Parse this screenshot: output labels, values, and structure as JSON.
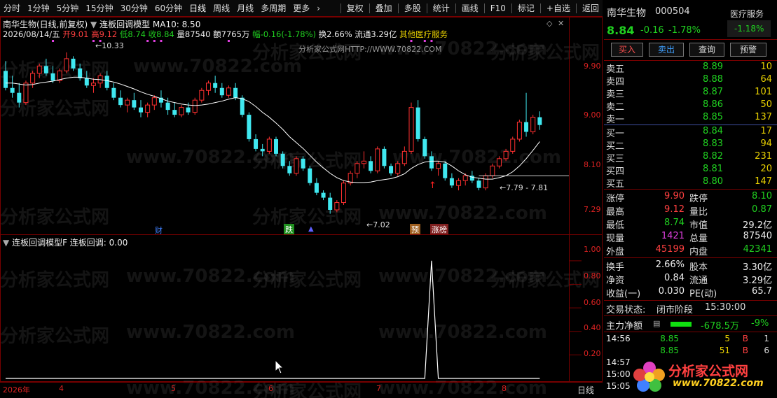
{
  "toolbar": {
    "items": [
      "分时",
      "1分钟",
      "5分钟",
      "15分钟",
      "30分钟",
      "60分钟",
      "日线",
      "周线",
      "月线",
      "多周期",
      "更多"
    ],
    "right_items": [
      "复权",
      "叠加",
      "多股",
      "统计",
      "画线",
      "F10",
      "标记",
      "+自选",
      "返回"
    ]
  },
  "header": {
    "title": "南华生物(日线,前复权)",
    "indicator": "连板回调模型",
    "ma": "MA10: 8.50",
    "date": "2026/08/14/五",
    "open_label": "开",
    "open": "9.01",
    "high_label": "高",
    "high": "9.12",
    "low_label": "低",
    "low": "8.74",
    "close_label": "收",
    "close": "8.84",
    "vol_label": "量",
    "vol": "87540",
    "amt_label": "额",
    "amt": "7765万",
    "chg_label": "幅",
    "chg": "-0.16(-1.78%)",
    "turn": "换2.66%",
    "float": "流通3.29亿",
    "sector": "其他医疗服务",
    "center_text": "分析家公式网HTTP://WWW.70822.COM"
  },
  "watermarks": [
    "分析家公式网",
    "www.70822.com"
  ],
  "price_axis": [
    "9.90",
    "9.00",
    "8.10",
    "7.29"
  ],
  "annotations": {
    "high_mark": "10.33",
    "low_mark": "7.02",
    "range_mark": "7.79 - 7.81"
  },
  "event_tags": [
    {
      "text": "财",
      "color": "#4080ff"
    },
    {
      "text": "跌",
      "color": "#20c020"
    },
    {
      "text": "预",
      "color": "#e08020"
    },
    {
      "text": "涨榜",
      "color": "#e04040"
    }
  ],
  "sub_header": {
    "name": "连板回调模型F",
    "value": "连板回调: 0.00"
  },
  "sub_axis": [
    "1.00",
    "0.80",
    "0.60",
    "0.40",
    "0.20"
  ],
  "date_axis": [
    "2026年",
    "4",
    "5",
    "6",
    "7",
    "8"
  ],
  "bottom_tab": "日线",
  "chart_data": {
    "type": "candlestick",
    "main": {
      "ylim": [
        7.0,
        10.5
      ],
      "ohlc": [
        [
          9.95,
          10.15,
          9.55,
          9.6
        ],
        [
          9.6,
          9.85,
          9.4,
          9.5
        ],
        [
          9.5,
          9.7,
          9.2,
          9.3
        ],
        [
          9.3,
          9.75,
          9.25,
          9.7
        ],
        [
          9.7,
          9.95,
          9.6,
          9.9
        ],
        [
          9.9,
          10.1,
          9.8,
          10.05
        ],
        [
          10.05,
          10.2,
          9.85,
          9.9
        ],
        [
          9.9,
          10.05,
          9.7,
          9.75
        ],
        [
          9.75,
          10.0,
          9.7,
          9.95
        ],
        [
          9.95,
          10.33,
          9.9,
          10.2
        ],
        [
          10.2,
          10.25,
          9.95,
          10.0
        ],
        [
          10.0,
          10.1,
          9.75,
          9.8
        ],
        [
          9.8,
          9.95,
          9.6,
          9.65
        ],
        [
          9.65,
          9.8,
          9.5,
          9.7
        ],
        [
          9.7,
          9.9,
          9.6,
          9.85
        ],
        [
          9.85,
          9.95,
          9.55,
          9.6
        ],
        [
          9.6,
          9.7,
          9.35,
          9.4
        ],
        [
          9.4,
          9.55,
          9.2,
          9.25
        ],
        [
          9.25,
          9.4,
          9.1,
          9.35
        ],
        [
          9.35,
          9.5,
          9.15,
          9.2
        ],
        [
          9.2,
          9.35,
          9.0,
          9.1
        ],
        [
          9.1,
          9.3,
          9.0,
          9.25
        ],
        [
          9.25,
          9.45,
          9.15,
          9.4
        ],
        [
          9.4,
          9.55,
          9.2,
          9.3
        ],
        [
          9.3,
          9.4,
          9.05,
          9.15
        ],
        [
          9.15,
          9.3,
          9.0,
          9.05
        ],
        [
          9.05,
          9.25,
          9.0,
          9.2
        ],
        [
          9.2,
          9.3,
          9.05,
          9.1
        ],
        [
          9.1,
          9.4,
          9.05,
          9.35
        ],
        [
          9.35,
          9.6,
          9.3,
          9.55
        ],
        [
          9.55,
          9.75,
          9.45,
          9.7
        ],
        [
          9.7,
          9.85,
          9.5,
          9.6
        ],
        [
          9.6,
          9.7,
          9.4,
          9.45
        ],
        [
          9.45,
          9.65,
          9.4,
          9.6
        ],
        [
          9.6,
          9.7,
          9.35,
          9.4
        ],
        [
          9.4,
          9.45,
          9.0,
          9.05
        ],
        [
          9.05,
          9.1,
          8.5,
          8.55
        ],
        [
          8.55,
          8.65,
          8.3,
          8.35
        ],
        [
          8.35,
          8.45,
          8.2,
          8.3
        ],
        [
          8.3,
          8.6,
          8.25,
          8.55
        ],
        [
          8.55,
          8.6,
          8.2,
          8.25
        ],
        [
          8.25,
          8.3,
          7.95,
          8.0
        ],
        [
          8.0,
          8.1,
          7.8,
          7.85
        ],
        [
          7.85,
          8.2,
          7.8,
          8.15
        ],
        [
          8.15,
          8.2,
          7.9,
          7.95
        ],
        [
          7.95,
          8.0,
          7.6,
          7.65
        ],
        [
          7.65,
          7.75,
          7.4,
          7.45
        ],
        [
          7.45,
          7.5,
          7.3,
          7.35
        ],
        [
          7.35,
          7.45,
          7.02,
          7.1
        ],
        [
          7.1,
          7.3,
          7.05,
          7.25
        ],
        [
          7.25,
          7.7,
          7.2,
          7.65
        ],
        [
          7.65,
          7.9,
          7.6,
          7.85
        ],
        [
          7.85,
          8.1,
          7.75,
          8.05
        ],
        [
          8.05,
          8.3,
          7.95,
          8.1
        ],
        [
          8.1,
          8.2,
          7.85,
          7.9
        ],
        [
          7.9,
          8.4,
          7.85,
          8.35
        ],
        [
          8.35,
          8.4,
          7.95,
          8.0
        ],
        [
          8.0,
          8.05,
          7.8,
          7.85
        ],
        [
          7.85,
          8.1,
          7.8,
          8.05
        ],
        [
          8.05,
          8.4,
          8.0,
          8.3
        ],
        [
          8.3,
          9.3,
          8.25,
          9.2
        ],
        [
          9.2,
          9.35,
          8.5,
          8.55
        ],
        [
          8.55,
          8.6,
          8.15,
          8.2
        ],
        [
          8.2,
          8.3,
          7.9,
          7.95
        ],
        [
          7.95,
          8.1,
          7.8,
          8.05
        ],
        [
          8.05,
          8.1,
          7.7,
          7.75
        ],
        [
          7.75,
          7.85,
          7.55,
          7.6
        ],
        [
          7.6,
          7.75,
          7.5,
          7.7
        ],
        [
          7.7,
          7.85,
          7.6,
          7.8
        ],
        [
          7.8,
          7.9,
          7.65,
          7.7
        ],
        [
          7.7,
          7.75,
          7.5,
          7.55
        ],
        [
          7.55,
          7.85,
          7.5,
          7.8
        ],
        [
          7.8,
          8.05,
          7.75,
          8.0
        ],
        [
          8.0,
          8.2,
          7.95,
          8.15
        ],
        [
          8.15,
          8.35,
          8.1,
          8.3
        ],
        [
          8.3,
          8.6,
          8.25,
          8.55
        ],
        [
          8.55,
          8.95,
          8.5,
          8.9
        ],
        [
          8.9,
          9.5,
          8.6,
          8.7
        ],
        [
          8.7,
          9.05,
          8.65,
          9.0
        ],
        [
          9.0,
          9.12,
          8.74,
          8.84
        ]
      ],
      "ma10": [
        9.7,
        9.7,
        9.68,
        9.66,
        9.67,
        9.7,
        9.72,
        9.74,
        9.77,
        9.8,
        9.82,
        9.82,
        9.8,
        9.78,
        9.77,
        9.75,
        9.72,
        9.68,
        9.63,
        9.58,
        9.52,
        9.47,
        9.43,
        9.38,
        9.33,
        9.3,
        9.27,
        9.25,
        9.24,
        9.25,
        9.27,
        9.3,
        9.33,
        9.37,
        9.4,
        9.38,
        9.32,
        9.22,
        9.1,
        9.0,
        8.88,
        8.75,
        8.6,
        8.48,
        8.36,
        8.22,
        8.08,
        7.96,
        7.85,
        7.76,
        7.7,
        7.67,
        7.66,
        7.66,
        7.67,
        7.7,
        7.72,
        7.74,
        7.78,
        7.84,
        7.95,
        8.03,
        8.08,
        8.1,
        8.1,
        8.08,
        8.0,
        7.9,
        7.82,
        7.77,
        7.75,
        7.73,
        7.73,
        7.76,
        7.8,
        7.88,
        8.0,
        8.15,
        8.32,
        8.5
      ]
    },
    "sub": {
      "name": "连板回调",
      "ylim": [
        0,
        1.1
      ],
      "spike_index": 63,
      "spike_value": 1.0
    }
  },
  "quote": {
    "name": "南华生物",
    "code": "000504",
    "sector_badge": "医疗服务",
    "price": "8.84",
    "change": "-0.16",
    "pct": "-1.78%",
    "sector_pct": "-1.18%",
    "buttons": [
      "买入",
      "卖出",
      "查询",
      "预警"
    ],
    "asks": [
      {
        "label": "卖五",
        "price": "8.89",
        "vol": "10"
      },
      {
        "label": "卖四",
        "price": "8.88",
        "vol": "64"
      },
      {
        "label": "卖三",
        "price": "8.87",
        "vol": "101"
      },
      {
        "label": "卖二",
        "price": "8.86",
        "vol": "50"
      },
      {
        "label": "卖一",
        "price": "8.85",
        "vol": "137"
      }
    ],
    "bids": [
      {
        "label": "买一",
        "price": "8.84",
        "vol": "17"
      },
      {
        "label": "买二",
        "price": "8.83",
        "vol": "94"
      },
      {
        "label": "买三",
        "price": "8.82",
        "vol": "231"
      },
      {
        "label": "买四",
        "price": "8.81",
        "vol": "20"
      },
      {
        "label": "买五",
        "price": "8.80",
        "vol": "147"
      }
    ],
    "stats": [
      {
        "l1": "涨停",
        "v1": "9.90",
        "c1": "red",
        "l2": "跌停",
        "v2": "8.10",
        "c2": "green"
      },
      {
        "l1": "最高",
        "v1": "9.12",
        "c1": "red",
        "l2": "量比",
        "v2": "0.87",
        "c2": "green"
      },
      {
        "l1": "最低",
        "v1": "8.74",
        "c1": "green",
        "l2": "市值",
        "v2": "29.2亿",
        "c2": "white"
      },
      {
        "l1": "现量",
        "v1": "1421",
        "c1": "purple",
        "l2": "总量",
        "v2": "87540",
        "c2": "white"
      },
      {
        "l1": "外盘",
        "v1": "45199",
        "c1": "red",
        "l2": "内盘",
        "v2": "42341",
        "c2": "green"
      }
    ],
    "stats2": [
      {
        "l1": "换手",
        "v1": "2.66%",
        "l2": "股本",
        "v2": "3.30亿"
      },
      {
        "l1": "净资",
        "v1": "0.84",
        "l2": "流通",
        "v2": "3.29亿"
      },
      {
        "l1": "收益(一)",
        "v1": "0.030",
        "l2": "PE(动)",
        "v2": "65.7"
      }
    ],
    "status_label": "交易状态:",
    "status": "闭市阶段",
    "status_time": "15:30:00",
    "mainforce_label": "主力净额",
    "mainforce": "-678.5万",
    "mainforce_pct": "-9%",
    "ticks": [
      {
        "time": "14:56",
        "price": "8.85",
        "vol": "5",
        "bs": "B",
        "n": "1"
      },
      {
        "time": "",
        "price": "8.85",
        "vol": "51",
        "bs": "B",
        "n": "6"
      },
      {
        "time": "14:57",
        "price": "",
        "vol": "",
        "bs": "",
        "n": ""
      },
      {
        "time": "15:00",
        "price": "",
        "vol": "",
        "bs": "",
        "n": ""
      },
      {
        "time": "15:05",
        "price": "",
        "vol": "",
        "bs": "",
        "n": ""
      }
    ],
    "logo_text": "分析家公式网",
    "logo_url": "www.70822.com"
  }
}
